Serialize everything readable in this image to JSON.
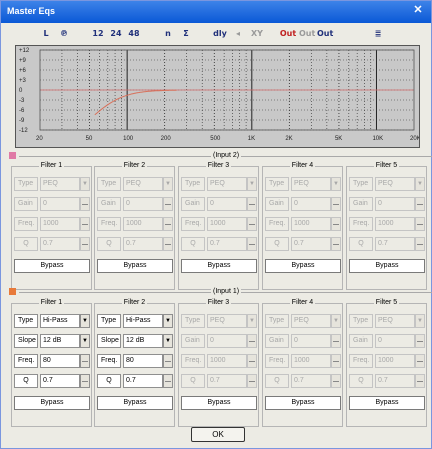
{
  "window": {
    "title": "Master Eqs",
    "close_glyph": "✕"
  },
  "toolbar": [
    {
      "name": "left-icon",
      "label": "L",
      "style": ""
    },
    {
      "name": "headphone-icon",
      "label": "℗",
      "style": ""
    },
    {
      "name": "slope-12-icon",
      "label": "12",
      "style": ""
    },
    {
      "name": "slope-24-icon",
      "label": "24",
      "style": ""
    },
    {
      "name": "slope-48-icon",
      "label": "48",
      "style": ""
    },
    {
      "name": "n-icon",
      "label": "n",
      "style": ""
    },
    {
      "name": "sum-icon",
      "label": "Σ",
      "style": ""
    },
    {
      "name": "dly-button",
      "label": "dly",
      "style": ""
    },
    {
      "name": "speaker-icon",
      "label": "◂",
      "style": "dis"
    },
    {
      "name": "xy-button",
      "label": "XY",
      "style": "dis"
    },
    {
      "name": "out1-button",
      "label": "Out 1",
      "style": "r"
    },
    {
      "name": "out2-button",
      "label": "Out 2",
      "style": "dis"
    },
    {
      "name": "out3-button",
      "label": "Out 3",
      "style": ""
    },
    {
      "name": "blank-button",
      "label": "",
      "style": ""
    },
    {
      "name": "notes-icon",
      "label": "≣",
      "style": ""
    }
  ],
  "graph": {
    "y_ticks": [
      "+12",
      "+9",
      "+6",
      "+3",
      "0",
      "-3",
      "-6",
      "-9",
      "-12"
    ],
    "x_ticks": [
      "20",
      "50",
      "100",
      "200",
      "500",
      "1K",
      "2K",
      "5K",
      "10K",
      "20K"
    ],
    "accent": "#d06a6a"
  },
  "input2": {
    "label": "(Input 2)",
    "color": "#e07aa6",
    "filters": [
      {
        "title": "Filter 1",
        "type_label": "Type",
        "type_value": "PEQ",
        "gain_label": "Gain",
        "gain_value": "0",
        "freq_label": "Freq.",
        "freq_value": "1000",
        "q_label": "Q",
        "q_value": "0.7",
        "bypass": "Bypass",
        "enabled": false,
        "row2": "gain"
      },
      {
        "title": "Filter 2",
        "type_label": "Type",
        "type_value": "PEQ",
        "gain_label": "Gain",
        "gain_value": "0",
        "freq_label": "Freq.",
        "freq_value": "1000",
        "q_label": "Q",
        "q_value": "0.7",
        "bypass": "Bypass",
        "enabled": false,
        "row2": "gain"
      },
      {
        "title": "Filter 3",
        "type_label": "Type",
        "type_value": "PEQ",
        "gain_label": "Gain",
        "gain_value": "0",
        "freq_label": "Freq.",
        "freq_value": "1000",
        "q_label": "Q",
        "q_value": "0.7",
        "bypass": "Bypass",
        "enabled": false,
        "row2": "gain"
      },
      {
        "title": "Filter 4",
        "type_label": "Type",
        "type_value": "PEQ",
        "gain_label": "Gain",
        "gain_value": "0",
        "freq_label": "Freq.",
        "freq_value": "1000",
        "q_label": "Q",
        "q_value": "0.7",
        "bypass": "Bypass",
        "enabled": false,
        "row2": "gain"
      },
      {
        "title": "Filter 5",
        "type_label": "Type",
        "type_value": "PEQ",
        "gain_label": "Gain",
        "gain_value": "0",
        "freq_label": "Freq.",
        "freq_value": "1000",
        "q_label": "Q",
        "q_value": "0.7",
        "bypass": "Bypass",
        "enabled": false,
        "row2": "gain"
      }
    ]
  },
  "input1": {
    "label": "(Input 1)",
    "color": "#e87a3a",
    "filters": [
      {
        "title": "Filter 1",
        "type_label": "Type",
        "type_value": "Hi-Pass",
        "gain_label": "Slope",
        "gain_value": "12 dB",
        "freq_label": "Freq.",
        "freq_value": "80",
        "q_label": "Q",
        "q_value": "0.7",
        "bypass": "Bypass",
        "enabled": true,
        "row2": "slope"
      },
      {
        "title": "Filter 2",
        "type_label": "Type",
        "type_value": "Hi-Pass",
        "gain_label": "Slope",
        "gain_value": "12 dB",
        "freq_label": "Freq.",
        "freq_value": "80",
        "q_label": "Q",
        "q_value": "0.7",
        "bypass": "Bypass",
        "enabled": true,
        "row2": "slope"
      },
      {
        "title": "Filter 3",
        "type_label": "Type",
        "type_value": "PEQ",
        "gain_label": "Gain",
        "gain_value": "0",
        "freq_label": "Freq.",
        "freq_value": "1000",
        "q_label": "Q",
        "q_value": "0.7",
        "bypass": "Bypass",
        "enabled": false,
        "row2": "gain"
      },
      {
        "title": "Filter 4",
        "type_label": "Type",
        "type_value": "PEQ",
        "gain_label": "Gain",
        "gain_value": "0",
        "freq_label": "Freq.",
        "freq_value": "1000",
        "q_label": "Q",
        "q_value": "0.7",
        "bypass": "Bypass",
        "enabled": false,
        "row2": "gain"
      },
      {
        "title": "Filter 5",
        "type_label": "Type",
        "type_value": "PEQ",
        "gain_label": "Gain",
        "gain_value": "0",
        "freq_label": "Freq.",
        "freq_value": "1000",
        "q_label": "Q",
        "q_value": "0.7",
        "bypass": "Bypass",
        "enabled": false,
        "row2": "gain"
      }
    ]
  },
  "ok_label": "OK"
}
